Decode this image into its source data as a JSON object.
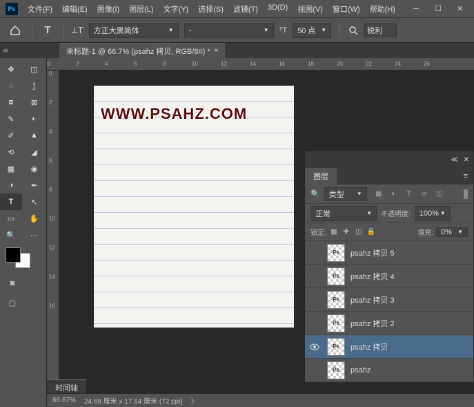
{
  "menu": [
    "文件(F)",
    "编辑(E)",
    "图像(I)",
    "图层(L)",
    "文字(Y)",
    "选择(S)",
    "滤镜(T)",
    "3D(D)",
    "视图(V)",
    "窗口(W)",
    "帮助(H)"
  ],
  "options": {
    "font_family": "方正大黑简体",
    "font_style": "-",
    "font_size": "50 点",
    "search_mode": "锐利"
  },
  "document": {
    "tab_title": "未标题-1 @ 66.7% (psahz 拷贝, RGB/8#) *",
    "zoom": "66.67%",
    "dims": "24.69 厘米 x 17.64 厘米 (72 ppi)",
    "watermark": "WWW.PSAHZ.COM"
  },
  "ruler_h": [
    "0",
    "2",
    "4",
    "6",
    "8",
    "10",
    "12",
    "14",
    "16",
    "18",
    "20",
    "22",
    "24",
    "26"
  ],
  "ruler_v": [
    "0",
    "2",
    "4",
    "6",
    "8",
    "10",
    "12",
    "14",
    "16"
  ],
  "panels": {
    "title": "图层",
    "filter_label": "类型",
    "blend_mode": "正常",
    "opacity_label": "不透明度:",
    "opacity": "100%",
    "lock_label": "锁定:",
    "fill_label": "填充:",
    "fill": "0%",
    "layers": [
      {
        "name": "psahz 拷贝 5",
        "visible": false,
        "selected": false
      },
      {
        "name": "psahz 拷贝 4",
        "visible": false,
        "selected": false
      },
      {
        "name": "psahz 拷贝 3",
        "visible": false,
        "selected": false
      },
      {
        "name": "psahz 拷贝 2",
        "visible": false,
        "selected": false
      },
      {
        "name": "psahz 拷贝",
        "visible": true,
        "selected": true
      },
      {
        "name": "psahz",
        "visible": false,
        "selected": false
      }
    ]
  },
  "timeline_tab": "时间轴"
}
